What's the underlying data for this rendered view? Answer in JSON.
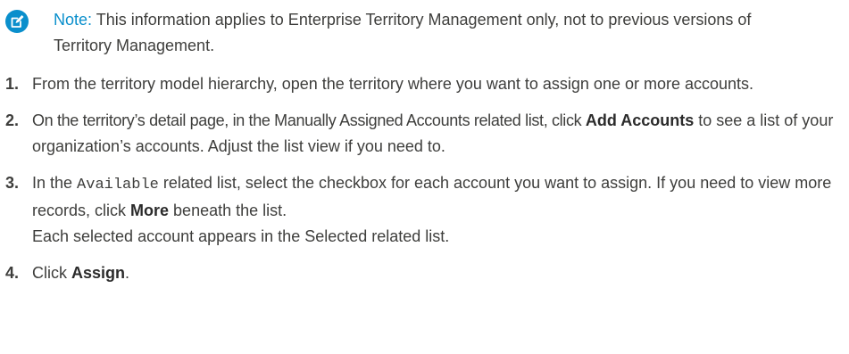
{
  "colors": {
    "note_accent": "#0a8fcc",
    "text": "#3e3e3c"
  },
  "note": {
    "icon": "edit-note-icon",
    "label": "Note:",
    "text": " This information applies to Enterprise Territory Management only, not to previous versions of Territory Management."
  },
  "steps": [
    {
      "number": "1.",
      "text": "From the territory model hierarchy, open the territory where you want to assign one or more accounts."
    },
    {
      "number": "2.",
      "text_before": "On the territory’s detail page, in the Manually Assigned Accounts related list, click ",
      "bold": "Add Accounts",
      "text_after": " to see a list of your organization’s accounts. Adjust the list view if you need to."
    },
    {
      "number": "3.",
      "text_before": "In the ",
      "code": "Available",
      "text_middle": " related list, select the checkbox for each account you want to assign. If you need to view more records, click ",
      "bold": "More",
      "text_after": " beneath the list.",
      "line2": "Each selected account appears in the Selected related list."
    },
    {
      "number": "4.",
      "text_before": "Click ",
      "bold": "Assign",
      "text_after": "."
    }
  ]
}
